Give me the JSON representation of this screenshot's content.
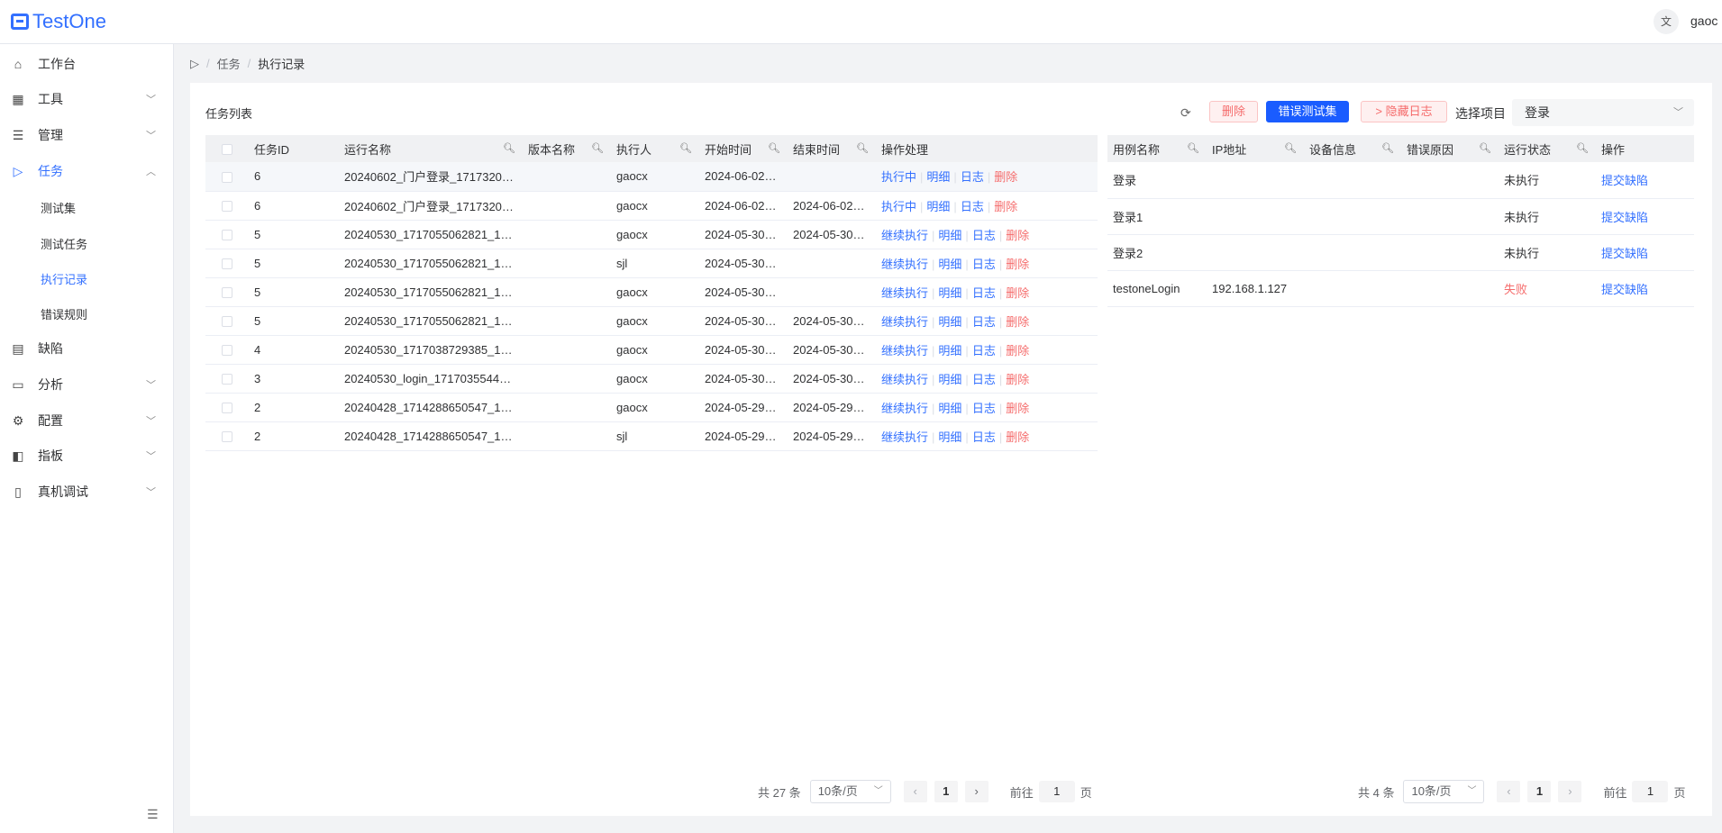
{
  "app": {
    "logo": "TestOne",
    "user": "gaoc",
    "lang_icon": "translate-icon"
  },
  "sidebar": {
    "items": [
      {
        "label": "工作台",
        "icon": "home-icon"
      },
      {
        "label": "工具",
        "icon": "grid-icon"
      },
      {
        "label": "管理",
        "icon": "list-icon"
      },
      {
        "label": "任务",
        "icon": "send-icon"
      },
      {
        "label": "缺陷",
        "icon": "document-icon"
      },
      {
        "label": "分析",
        "icon": "calendar-icon"
      },
      {
        "label": "配置",
        "icon": "gear-icon"
      },
      {
        "label": "指板",
        "icon": "layout-icon"
      },
      {
        "label": "真机调试",
        "icon": "device-icon"
      }
    ],
    "sub_items": [
      {
        "label": "测试集"
      },
      {
        "label": "测试任务"
      },
      {
        "label": "执行记录"
      },
      {
        "label": "错误规则"
      }
    ]
  },
  "breadcrumb": {
    "parent": "任务",
    "current": "执行记录"
  },
  "panel": {
    "title": "任务列表"
  },
  "toolbar": {
    "delete": "删除",
    "error_set": "错误测试集",
    "hide_log": "> 隐藏日志",
    "project_label": "选择项目",
    "project_value": "登录"
  },
  "left_table": {
    "headers": [
      "任务ID",
      "运行名称",
      "版本名称",
      "执行人",
      "开始时间",
      "结束时间",
      "操作处理"
    ],
    "rows": [
      {
        "id": "6",
        "name": "20240602_门户登录_1717320…",
        "version": "",
        "executor": "gaocx",
        "start": "2024-06-02…",
        "end": "",
        "action": "执行中"
      },
      {
        "id": "6",
        "name": "20240602_门户登录_1717320…",
        "version": "",
        "executor": "gaocx",
        "start": "2024-06-02…",
        "end": "2024-06-02…",
        "action": "执行中"
      },
      {
        "id": "5",
        "name": "20240530_1717055062821_1…",
        "version": "",
        "executor": "gaocx",
        "start": "2024-05-30…",
        "end": "2024-05-30…",
        "action": "继续执行"
      },
      {
        "id": "5",
        "name": "20240530_1717055062821_1…",
        "version": "",
        "executor": "sjl",
        "start": "2024-05-30…",
        "end": "",
        "action": "继续执行"
      },
      {
        "id": "5",
        "name": "20240530_1717055062821_1…",
        "version": "",
        "executor": "gaocx",
        "start": "2024-05-30…",
        "end": "",
        "action": "继续执行"
      },
      {
        "id": "5",
        "name": "20240530_1717055062821_1…",
        "version": "",
        "executor": "gaocx",
        "start": "2024-05-30…",
        "end": "2024-05-30…",
        "action": "继续执行"
      },
      {
        "id": "4",
        "name": "20240530_1717038729385_1…",
        "version": "",
        "executor": "gaocx",
        "start": "2024-05-30…",
        "end": "2024-05-30…",
        "action": "继续执行"
      },
      {
        "id": "3",
        "name": "20240530_login_1717035544…",
        "version": "",
        "executor": "gaocx",
        "start": "2024-05-30…",
        "end": "2024-05-30…",
        "action": "继续执行"
      },
      {
        "id": "2",
        "name": "20240428_1714288650547_1…",
        "version": "",
        "executor": "gaocx",
        "start": "2024-05-29…",
        "end": "2024-05-29…",
        "action": "继续执行"
      },
      {
        "id": "2",
        "name": "20240428_1714288650547_1…",
        "version": "",
        "executor": "sjl",
        "start": "2024-05-29…",
        "end": "2024-05-29…",
        "action": "继续执行"
      }
    ],
    "op_detail": "明细",
    "op_log": "日志",
    "op_delete": "删除"
  },
  "right_table": {
    "headers": [
      "用例名称",
      "IP地址",
      "设备信息",
      "错误原因",
      "运行状态",
      "操作"
    ],
    "rows": [
      {
        "name": "登录",
        "ip": "",
        "device": "",
        "reason": "",
        "status": "未执行",
        "op": "提交缺陷"
      },
      {
        "name": "登录1",
        "ip": "",
        "device": "",
        "reason": "",
        "status": "未执行",
        "op": "提交缺陷"
      },
      {
        "name": "登录2",
        "ip": "",
        "device": "",
        "reason": "",
        "status": "未执行",
        "op": "提交缺陷"
      },
      {
        "name": "testoneLogin",
        "ip": "192.168.1.127",
        "device": "",
        "reason": "",
        "status": "失败",
        "op": "提交缺陷"
      }
    ]
  },
  "left_pager": {
    "total": "共 27 条",
    "size": "10条/页",
    "page": "1",
    "goto": "前往",
    "jump": "1",
    "unit": "页"
  },
  "right_pager": {
    "total": "共 4 条",
    "size": "10条/页",
    "page": "1",
    "goto": "前往",
    "jump": "1",
    "unit": "页"
  },
  "colors": {
    "accent": "#3370ff",
    "danger": "#f56c6c",
    "primary_btn": "#1a5cff"
  }
}
